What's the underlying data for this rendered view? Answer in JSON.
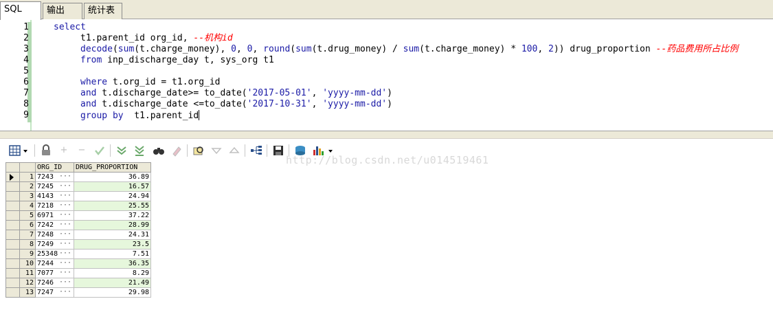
{
  "tabs": [
    {
      "label": "SQL"
    },
    {
      "label": "输出"
    },
    {
      "label": "统计表"
    }
  ],
  "editor": {
    "line_numbers": [
      "1",
      "2",
      "3",
      "4",
      "5",
      "6",
      "7",
      "8",
      "9"
    ],
    "lines": {
      "l1": "select",
      "l2_a": "t1.parent_id org_id, ",
      "l2_cm": "--机构id",
      "l3_fn1": "decode",
      "l3_a": "(",
      "l3_fn2": "sum",
      "l3_b": "(t.charge_money), ",
      "l3_n1": "0",
      "l3_c": ", ",
      "l3_n2": "0",
      "l3_d": ", ",
      "l3_fn3": "round",
      "l3_e": "(",
      "l3_fn4": "sum",
      "l3_f": "(t.drug_money) / ",
      "l3_fn5": "sum",
      "l3_g": "(t.charge_money) * ",
      "l3_n3": "100",
      "l3_h": ", ",
      "l3_n4": "2",
      "l3_i": ")) drug_proportion ",
      "l3_cm": "--药品费用所占比例",
      "l4_kw": "from",
      "l4_a": " inp_discharge_day t, sys_org t1",
      "l6_kw": "where",
      "l6_a": " t.org_id = t1.org_id",
      "l7_kw": "and",
      "l7_a": " t.discharge_date>= to_date(",
      "l7_s1": "'2017-05-01'",
      "l7_b": ", ",
      "l7_s2": "'yyyy-mm-dd'",
      "l7_c": ")",
      "l8_kw": "and",
      "l8_a": " t.discharge_date <=to_date(",
      "l8_s1": "'2017-10-31'",
      "l8_b": ", ",
      "l8_s2": "'yyyy-mm-dd'",
      "l8_c": ")",
      "l9_kw": "group by",
      "l9_a": "  t1.parent_id"
    }
  },
  "toolbar": {
    "icons": [
      "grid-view-icon",
      "lock-icon",
      "add-record-icon",
      "delete-record-icon",
      "post-icon",
      "fetch-next-icon",
      "fetch-all-icon",
      "find-icon",
      "clear-icon",
      "query-by-example-icon",
      "filter-icon",
      "sort-icon",
      "explain-icon",
      "save-icon",
      "export-icon",
      "chart-icon"
    ]
  },
  "watermark": "http://blog.csdn.net/u014519461",
  "grid": {
    "columns": [
      "ORG_ID",
      "DRUG_PROPORTION"
    ],
    "ellipsis": "···",
    "rows": [
      {
        "n": "1",
        "org_id": "7243",
        "drug_proportion": "36.89"
      },
      {
        "n": "2",
        "org_id": "7245",
        "drug_proportion": "16.57"
      },
      {
        "n": "3",
        "org_id": "4143",
        "drug_proportion": "24.94"
      },
      {
        "n": "4",
        "org_id": "7218",
        "drug_proportion": "25.55"
      },
      {
        "n": "5",
        "org_id": "6971",
        "drug_proportion": "37.22"
      },
      {
        "n": "6",
        "org_id": "7242",
        "drug_proportion": "28.99"
      },
      {
        "n": "7",
        "org_id": "7248",
        "drug_proportion": "24.31"
      },
      {
        "n": "8",
        "org_id": "7249",
        "drug_proportion": "23.5"
      },
      {
        "n": "9",
        "org_id": "25348",
        "drug_proportion": "7.51"
      },
      {
        "n": "10",
        "org_id": "7244",
        "drug_proportion": "36.35"
      },
      {
        "n": "11",
        "org_id": "7077",
        "drug_proportion": "8.29"
      },
      {
        "n": "12",
        "org_id": "7246",
        "drug_proportion": "21.49"
      },
      {
        "n": "13",
        "org_id": "7247",
        "drug_proportion": "29.98"
      }
    ]
  }
}
